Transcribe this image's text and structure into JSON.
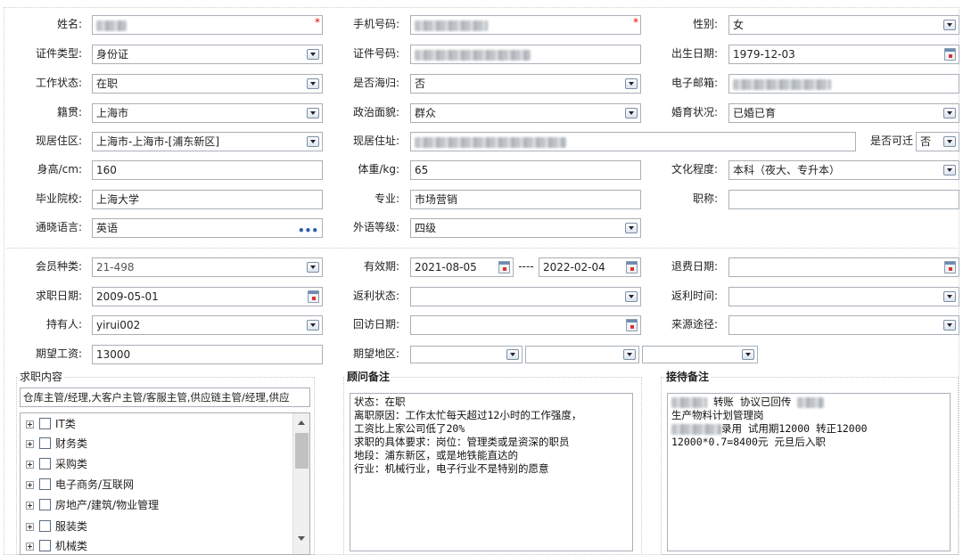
{
  "personal": {
    "name": {
      "label": "姓名:",
      "required": "*"
    },
    "phone": {
      "label": "手机号码:",
      "required": "*"
    },
    "gender": {
      "label": "性别:",
      "value": "女"
    },
    "id_type": {
      "label": "证件类型:",
      "value": "身份证"
    },
    "id_number": {
      "label": "证件号码:"
    },
    "birth_date": {
      "label": "出生日期:",
      "value": "1979-12-03"
    },
    "work_status": {
      "label": "工作状态:",
      "value": "在职"
    },
    "overseas": {
      "label": "是否海归:",
      "value": "否"
    },
    "email": {
      "label": "电子邮箱:"
    },
    "native_place": {
      "label": "籍贯:",
      "value": "上海市"
    },
    "political": {
      "label": "政治面貌:",
      "value": "群众"
    },
    "marital": {
      "label": "婚育状况:",
      "value": "已婚已育"
    },
    "residence_area": {
      "label": "现居住区:",
      "value": "上海市-上海市-[浦东新区]"
    },
    "residence_addr": {
      "label": "现居住址:"
    },
    "relocate": {
      "label": "是否可迁",
      "value": "否"
    },
    "height": {
      "label": "身高/cm:",
      "value": "160"
    },
    "weight": {
      "label": "体重/kg:",
      "value": "65"
    },
    "education": {
      "label": "文化程度:",
      "value": "本科（夜大、专升本）"
    },
    "school": {
      "label": "毕业院校:",
      "value": "上海大学"
    },
    "major": {
      "label": "专业:",
      "value": "市场营销"
    },
    "title": {
      "label": "职称:",
      "value": ""
    },
    "language": {
      "label": "通晓语言:",
      "value": "英语",
      "more": "•••"
    },
    "lang_level": {
      "label": "外语等级:",
      "value": "四级"
    }
  },
  "membership": {
    "member_type": {
      "label": "会员种类:",
      "value": "21-498"
    },
    "validity": {
      "label": "有效期:",
      "from": "2021-08-05",
      "sep": "----",
      "to": "2022-02-04"
    },
    "refund_date": {
      "label": "退费日期:",
      "value": ""
    },
    "job_date": {
      "label": "求职日期:",
      "value": "2009-05-01"
    },
    "rebate_status": {
      "label": "返利状态:",
      "value": ""
    },
    "rebate_time": {
      "label": "返利时间:",
      "value": ""
    },
    "holder": {
      "label": "持有人:",
      "value": "yirui002"
    },
    "visit_date": {
      "label": "回访日期:",
      "value": ""
    },
    "source": {
      "label": "来源途径:",
      "value": ""
    },
    "salary": {
      "label": "期望工资:",
      "value": "13000"
    },
    "region": {
      "label": "期望地区:"
    }
  },
  "job_panel": {
    "title": "求职内容",
    "summary": "仓库主管/经理,大客户主管/客服主管,供应链主管/经理,供应",
    "tree_items": [
      "IT类",
      "财务类",
      "采购类",
      "电子商务/互联网",
      "房地产/建筑/物业管理",
      "服装类",
      "机械类"
    ]
  },
  "advisor_panel": {
    "title": "顾问备注",
    "text": "状态：在职\n离职原因：工作太忙每天超过12小时的工作强度，\n工资比上家公司低了20%\n求职的具体要求：岗位：管理类或是资深的职员\n地段：浦东新区，或是地铁能直达的\n行业：机械行业，电子行业不是特别的愿意"
  },
  "reception_panel": {
    "title": "接待备注",
    "line1_a": "转账",
    "line1_b": "协议已回传",
    "line2": "生产物料计划管理岗",
    "line3": "录用  试用期12000  转正12000",
    "line4": "12000*0.7=8400元  元旦后入职"
  }
}
